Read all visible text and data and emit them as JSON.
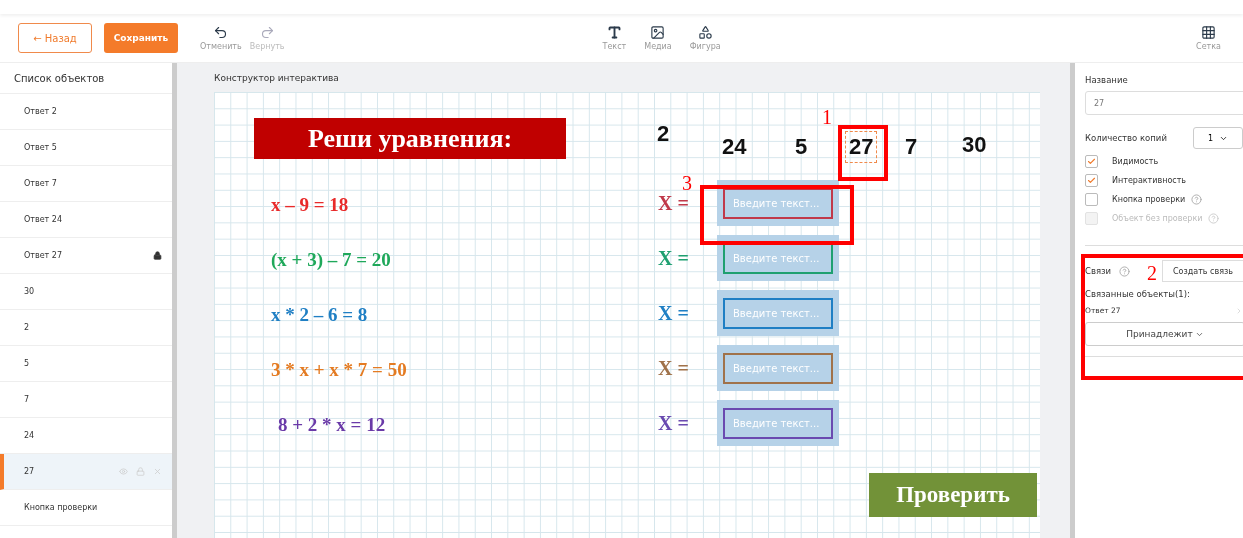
{
  "toolbar": {
    "back": "← Назад",
    "save": "Сохранить",
    "history": [
      {
        "kind": "undo",
        "label": "Отменить",
        "disabled": false
      },
      {
        "kind": "redo",
        "label": "Вернуть",
        "disabled": true
      }
    ],
    "tools": [
      {
        "kind": "text",
        "label": "Текст"
      },
      {
        "kind": "media",
        "label": "Медиа"
      },
      {
        "kind": "shape",
        "label": "Фигура"
      }
    ],
    "grid": {
      "kind": "grid",
      "label": "Сетка"
    }
  },
  "sidebar": {
    "title": "Список объектов",
    "items": [
      {
        "label": "Ответ 2",
        "selected": false,
        "locked": false
      },
      {
        "label": "Ответ 5",
        "selected": false,
        "locked": false
      },
      {
        "label": "Ответ 7",
        "selected": false,
        "locked": false
      },
      {
        "label": "Ответ 24",
        "selected": false,
        "locked": false
      },
      {
        "label": "Ответ 27",
        "selected": false,
        "locked": true
      },
      {
        "label": "30",
        "selected": false,
        "locked": false
      },
      {
        "label": "2",
        "selected": false,
        "locked": false
      },
      {
        "label": "5",
        "selected": false,
        "locked": false
      },
      {
        "label": "7",
        "selected": false,
        "locked": false
      },
      {
        "label": "24",
        "selected": false,
        "locked": false
      },
      {
        "label": "27",
        "selected": true,
        "locked": false
      },
      {
        "label": "Кнопка проверки",
        "selected": false,
        "locked": false
      }
    ]
  },
  "canvas": {
    "title": "Конструктор интерактива",
    "heading": "Реши уравнения:",
    "equations": [
      {
        "text": "x – 9 = 18",
        "color": "#e82a2a"
      },
      {
        "text": "(x + 3) – 7 = 20",
        "color": "#1fa85a"
      },
      {
        "text": "x * 2 – 6 = 8",
        "color": "#1f7fc4"
      },
      {
        "text": "3 * x + x * 7 = 50",
        "color": "#e47b22"
      },
      {
        "text": "8 + 2 * x = 12",
        "color": "#6a3aa8"
      }
    ],
    "answers": [
      {
        "label": "X =",
        "placeholder": "Введите текст...",
        "color": "#c0394a"
      },
      {
        "label": "X =",
        "placeholder": "Введите текст...",
        "color": "#1fa070"
      },
      {
        "label": "X =",
        "placeholder": "Введите текст...",
        "color": "#1f7fc4"
      },
      {
        "label": "X =",
        "placeholder": "Введите текст...",
        "color": "#a0724a"
      },
      {
        "label": "X =",
        "placeholder": "Введите текст...",
        "color": "#6a4ab0"
      }
    ],
    "number_tiles": [
      {
        "text": "2",
        "selected": false
      },
      {
        "text": "24",
        "selected": false
      },
      {
        "text": "5",
        "selected": false
      },
      {
        "text": "27",
        "selected": true
      },
      {
        "text": "7",
        "selected": false
      },
      {
        "text": "30",
        "selected": false
      }
    ],
    "check_button": "Проверить"
  },
  "properties": {
    "name_label": "Название",
    "name_value": "27",
    "copies_label": "Количество копий",
    "copies_value": "1",
    "options": [
      {
        "label": "Видимость",
        "checked": true,
        "disabled": false,
        "help": false
      },
      {
        "label": "Интерактивность",
        "checked": true,
        "disabled": false,
        "help": false
      },
      {
        "label": "Кнопка проверки",
        "checked": false,
        "disabled": false,
        "help": true
      },
      {
        "label": "Объект без проверки",
        "checked": false,
        "disabled": true,
        "help": true
      }
    ],
    "links_label": "Связи",
    "create_link": "Создать связь",
    "linked_label": "Связанные объекты(1):",
    "linked_item": "Ответ 27",
    "belongs": "Принадлежит"
  },
  "annotations": [
    "1",
    "2",
    "3"
  ]
}
